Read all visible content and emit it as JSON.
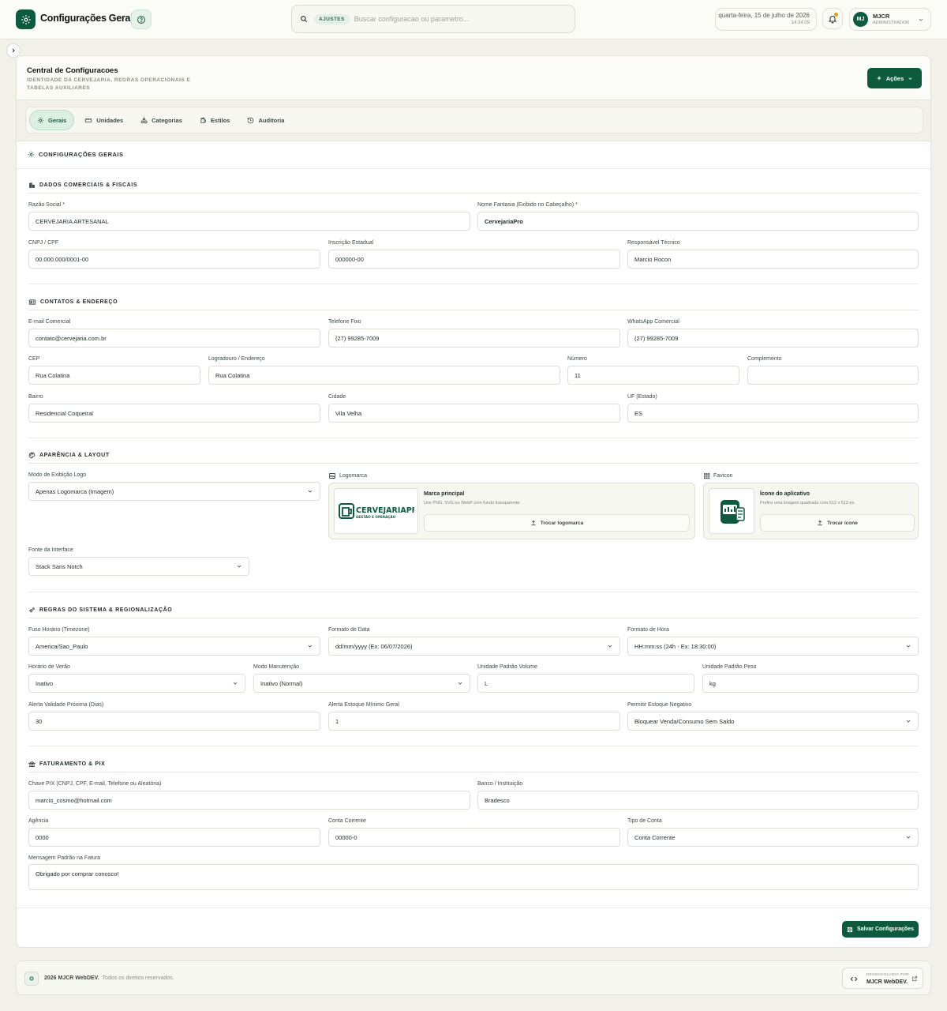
{
  "header": {
    "title": "Configurações Gerais",
    "search_chip": "AJUSTES",
    "search_placeholder": "Buscar configuracao ou parametro...",
    "date": "quarta-feira, 15 de julho de 2026",
    "time": "14:34:09",
    "user_initials": "MJ",
    "user_name": "MJCR",
    "user_role": "ADMINISTRADOR"
  },
  "page": {
    "title": "Central de Configuracoes",
    "subtitle": "IDENTIDADE DA CERVEJARIA, REGRAS OPERACIONAIS E TABELAS AUXILIARES",
    "actions_label": "Ações"
  },
  "tabs": [
    {
      "label": "Gerais",
      "active": true
    },
    {
      "label": "Unidades"
    },
    {
      "label": "Categorias"
    },
    {
      "label": "Estilos"
    },
    {
      "label": "Auditoria"
    }
  ],
  "card_title": "CONFIGURAÇÕES GERAIS",
  "sections": {
    "commercial": "DADOS COMERCIAIS & FISCAIS",
    "contacts": "CONTATOS & ENDEREÇO",
    "appearance": "APARÊNCIA & LAYOUT",
    "rules": "REGRAS DO SISTEMA & REGIONALIZAÇÃO",
    "billing": "FATURAMENTO & PIX"
  },
  "fields": {
    "razao": {
      "label": "Razão Social *",
      "value": "CERVEJARIA ARTESANAL"
    },
    "fantasia": {
      "label": "Nome Fantasia (Exibido no Cabeçalho) *",
      "value": "CervejariaPro"
    },
    "cnpj": {
      "label": "CNPJ / CPF",
      "value": "00.000.000/0001-00"
    },
    "ie": {
      "label": "Inscrição Estadual",
      "value": "000000-00"
    },
    "responsavel": {
      "label": "Responsável Técnico",
      "value": "Marcio Rocon"
    },
    "email": {
      "label": "E-mail Comercial",
      "value": "contato@cervejaria.com.br"
    },
    "telefone": {
      "label": "Telefone Fixo",
      "value": "(27) 99285-7009"
    },
    "whatsapp": {
      "label": "WhatsApp Comercial",
      "value": "(27) 99285-7009"
    },
    "cep": {
      "label": "CEP",
      "value": "Rua Colatina"
    },
    "logradouro": {
      "label": "Logradouro / Endereço",
      "value": "Rua Colatina"
    },
    "numero": {
      "label": "Número",
      "value": "11"
    },
    "complemento": {
      "label": "Complemento",
      "value": ""
    },
    "bairro": {
      "label": "Bairro",
      "value": "Residencial Coqueiral"
    },
    "cidade": {
      "label": "Cidade",
      "value": "Vila Velha"
    },
    "uf": {
      "label": "UF (Estado)",
      "value": "ES"
    },
    "modo_logo": {
      "label": "Modo de Exibição Logo",
      "value": "Apenas Logomarca (Imagem)"
    },
    "fonte": {
      "label": "Fonte da Interface",
      "value": "Stack Sans Notch"
    },
    "fuso": {
      "label": "Fuso Horário (Timezone)",
      "value": "America/Sao_Paulo"
    },
    "formato_data": {
      "label": "Formato de Data",
      "value": "dd/mm/yyyy (Ex: 06/07/2026)"
    },
    "formato_hora": {
      "label": "Formato de Hora",
      "value": "HH:mm:ss (24h - Ex: 18:30:00)"
    },
    "horario_verao": {
      "label": "Horário de Verão",
      "value": "Inativo"
    },
    "manutencao": {
      "label": "Modo Manutenção",
      "value": "Inativo (Normal)"
    },
    "und_volume": {
      "label": "Unidade Padrão Volume",
      "value": "L"
    },
    "und_peso": {
      "label": "Unidade Padrão Peso",
      "value": "kg"
    },
    "alerta_validade": {
      "label": "Alerta Validade Próxima (Dias)",
      "value": "30"
    },
    "alerta_estoque": {
      "label": "Alerta Estoque Mínimo Geral",
      "value": "1"
    },
    "estoque_negativo": {
      "label": "Permitir Estoque Negativo",
      "value": "Bloquear Venda/Consumo Sem Saldo"
    },
    "pix": {
      "label": "Chave PIX (CNPJ, CPF, E-mail, Telefone ou Aleatória)",
      "value": "marcio_cosmo@hotmail.com"
    },
    "banco": {
      "label": "Banco / Instituição",
      "value": "Bradesco"
    },
    "agencia": {
      "label": "Agência",
      "value": "0000"
    },
    "conta": {
      "label": "Conta Corrente",
      "value": "00000-0"
    },
    "tipo_conta": {
      "label": "Tipo de Conta",
      "value": "Conta Corrente"
    },
    "mensagem": {
      "label": "Mensagem Padrão na Fatura",
      "value": "Obrigado por comprar conosco!"
    }
  },
  "logo_upload": {
    "label": "Logomarca",
    "title": "Marca principal",
    "hint": "Use PNG, SVG ou WebP com fundo transparente.",
    "button": "Trocar logomarca",
    "brand_text": "CERVEJARIAPRO",
    "brand_sub": "GESTÃO E OPERAÇÃO"
  },
  "favicon_upload": {
    "label": "Favicon",
    "title": "Ícone do aplicativo",
    "hint": "Prefira uma imagem quadrada com 512 x 512 px.",
    "button": "Trocar ícone"
  },
  "save_label": "Salvar Configurações",
  "footer": {
    "brand": "2026 MJCR WebDEV.",
    "rights": "Todos os direitos reservados.",
    "dev_by": "DESENVOLVIDO POR",
    "dev_name": "MJCR WebDEV."
  },
  "colors": {
    "primary": "#0e5a3e",
    "accent_soft": "#dcefe3",
    "bg": "#f1f1ea"
  }
}
